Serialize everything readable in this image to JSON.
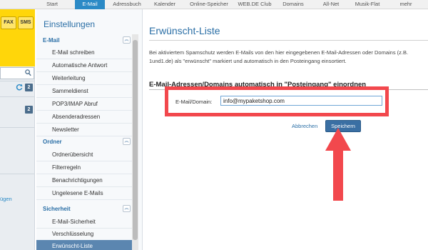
{
  "topnav": {
    "tabs": [
      {
        "label": "Start",
        "active": false
      },
      {
        "label": "E-Mail",
        "active": true
      },
      {
        "label": "Adressbuch",
        "active": false
      },
      {
        "label": "Kalender",
        "active": false
      },
      {
        "label": "Online-Speicher",
        "active": false
      },
      {
        "label": "WEB.DE Club",
        "active": false
      },
      {
        "label": "Domains",
        "active": false
      },
      {
        "label": "All-Net",
        "active": false
      },
      {
        "label": "Musik-Flat",
        "active": false
      },
      {
        "label": "mehr",
        "active": false
      }
    ]
  },
  "appstrip": {
    "fax_label": "FAX",
    "sms_label": "SMS",
    "badge_1": "2",
    "badge_2": "2",
    "partial_text": "ügen"
  },
  "sidebar": {
    "title": "Einstellungen",
    "sections": [
      {
        "heading": "E-Mail",
        "items": [
          "E-Mail schreiben",
          "Automatische Antwort",
          "Weiterleitung",
          "Sammeldienst",
          "POP3/IMAP Abruf",
          "Absenderadressen",
          "Newsletter"
        ]
      },
      {
        "heading": "Ordner",
        "items": [
          "Ordnerübersicht",
          "Filterregeln",
          "Benachrichtigungen",
          "Ungelesene E-Mails"
        ]
      },
      {
        "heading": "Sicherheit",
        "items": [
          "E-Mail-Sicherheit",
          "Verschlüsselung",
          "Erwünscht-Liste"
        ]
      }
    ],
    "active_item": "Erwünscht-Liste",
    "collapse_glyph": "︽"
  },
  "main": {
    "title": "Erwünscht-Liste",
    "description": "Bei aktiviertem Spamschutz werden E-Mails von den hier eingegebenen E-Mail-Adressen oder Domains (z.B. 1und1.de) als \"erwünscht\" markiert und automatisch in den Posteingang einsortiert.",
    "section_heading": "E-Mail-Adressen/Domains automatisch in \"Posteingang\" einordnen",
    "field_label": "E-Mail/Domain:",
    "field_value": "info@mypaketshop.com",
    "cancel_label": "Abbrechen",
    "save_label": "Speichern"
  },
  "colors": {
    "accent": "#2b8ac6",
    "brand_yellow": "#ffd60a",
    "annotation_red": "#f2484d",
    "active_item_bg": "#5b86b0"
  }
}
